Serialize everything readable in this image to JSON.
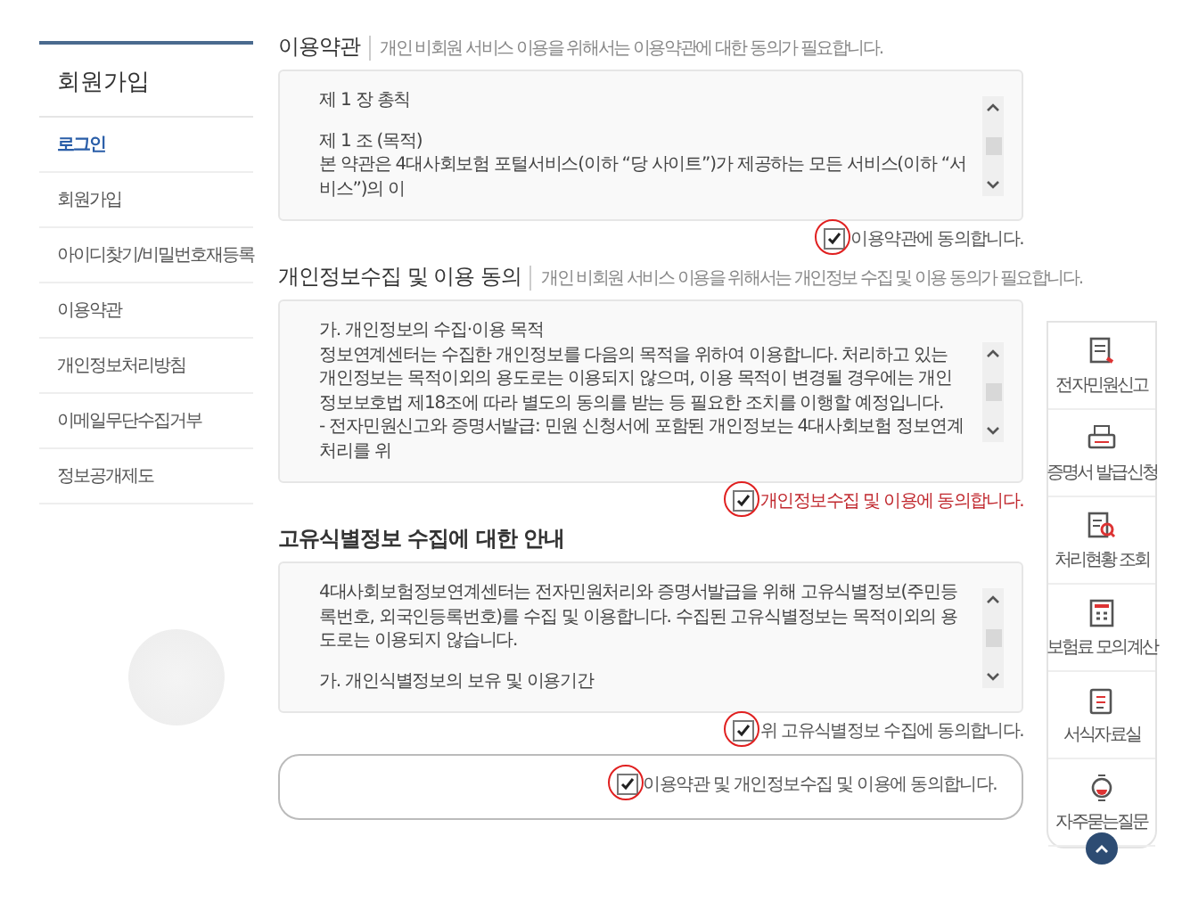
{
  "sidebar": {
    "title": "회원가입",
    "items": [
      {
        "label": "로그인",
        "selected": true
      },
      {
        "label": "회원가입",
        "selected": false
      },
      {
        "label": "아이디찾기/비밀번호재등록",
        "selected": false
      },
      {
        "label": "이용약관",
        "selected": false
      },
      {
        "label": "개인정보처리방침",
        "selected": false
      },
      {
        "label": "이메일무단수집거부",
        "selected": false
      },
      {
        "label": "정보공개제도",
        "selected": false
      }
    ]
  },
  "sections": [
    {
      "title": "이용약관",
      "subtitle": "개인 비회원 서비스 이용을 위해서는 이용약관에 대한 동의가 필요합니다.",
      "paragraphs": [
        "제 1 장 총칙",
        "제 1 조 (목적)\n본 약관은 4대사회보험 포털서비스(이하 “당 사이트”)가 제공하는 모든 서비스(이하 “서비스”)의 이"
      ],
      "agreement": {
        "label": "이용약관에 동의합니다.",
        "checked": true,
        "highlighted": false
      }
    },
    {
      "title": "개인정보수집 및 이용 동의",
      "subtitle": "개인 비회원 서비스 이용을 위해서는 개인정보 수집 및 이용 동의가 필요합니다.",
      "paragraphs": [
        "가. 개인정보의 수집·이용 목적\n정보연계센터는 수집한 개인정보를 다음의 목적을 위하여 이용합니다. 처리하고 있는 개인정보는 목적이외의 용도로는 이용되지 않으며, 이용 목적이 변경될 경우에는 개인정보보호법 제18조에 따라 별도의 동의를 받는 등 필요한 조치를 이행할 예정입니다.\n- 전자민원신고와 증명서발급: 민원 신청서에 포함된 개인정보는 4대사회보험 정보연계 처리를 위"
      ],
      "agreement": {
        "label": "개인정보수집 및 이용에 동의합니다.",
        "checked": true,
        "highlighted": true
      }
    },
    {
      "title": "고유식별정보 수집에 대한 안내",
      "paragraphs": [
        "4대사회보험정보연계센터는 전자민원처리와 증명서발급을 위해 고유식별정보(주민등록번호, 외국인등록번호)를 수집 및 이용합니다. 수집된 고유식별정보는 목적이외의 용도로는 이용되지 않습니다.",
        "가. 개인식별정보의 보유 및 이용기간"
      ],
      "agreement": {
        "label": "위 고유식별정보 수집에 동의합니다.",
        "checked": true,
        "highlighted": false
      }
    }
  ],
  "all_agreement": {
    "label": "이용약관 및 개인정보수집 및 이용에 동의합니다.",
    "checked": true
  },
  "quick_menu": [
    {
      "label": "전자민원신고",
      "kind": "document"
    },
    {
      "label": "증명서 발급신청",
      "kind": "printer"
    },
    {
      "label": "처리현황 조회",
      "kind": "search"
    },
    {
      "label": "보험료 모의계산",
      "kind": "calculator"
    },
    {
      "label": "서식자료실",
      "kind": "clipboard"
    },
    {
      "label": "자주묻는질문",
      "kind": "bulb"
    }
  ]
}
